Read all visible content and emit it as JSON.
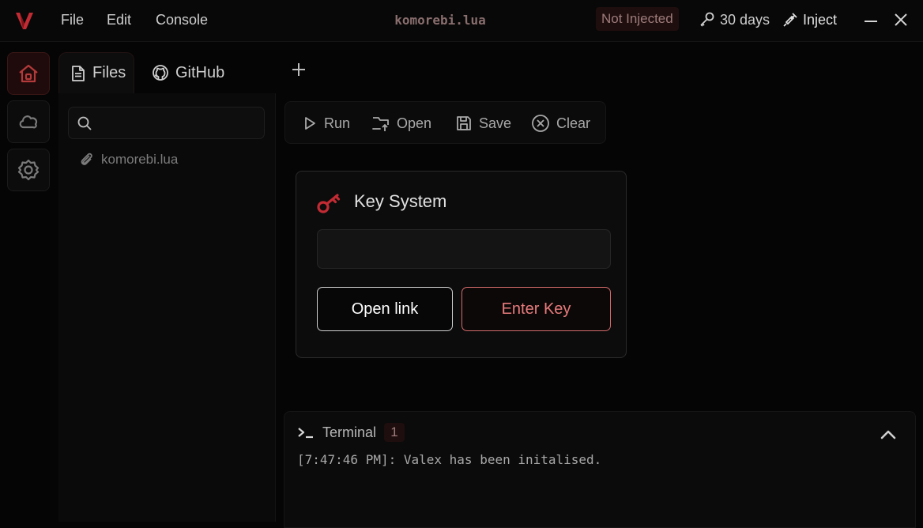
{
  "app": {
    "menu": [
      {
        "label": "File"
      },
      {
        "label": "Edit"
      },
      {
        "label": "Console"
      }
    ],
    "document_title": "komorebi.lua",
    "status_badge": "Not Injected",
    "key_days": "30 days",
    "inject_label": "Inject",
    "accent_color": "#c22b33"
  },
  "sidebar_tabs": [
    {
      "label": "Files",
      "icon": "file-icon"
    },
    {
      "label": "GitHub",
      "icon": "github-icon"
    }
  ],
  "search": {
    "placeholder": ""
  },
  "files": [
    {
      "name": "komorebi.lua",
      "icon": "link-icon"
    }
  ],
  "toolbar": {
    "run": "Run",
    "open": "Open",
    "save": "Save",
    "clear": "Clear"
  },
  "key_dialog": {
    "title": "Key System",
    "input_value": "",
    "open_link": "Open link",
    "enter_key": "Enter Key"
  },
  "terminal": {
    "title": "Terminal",
    "count": "1",
    "lines": [
      "[7:47:46 PM]: Valex has been initalised."
    ]
  }
}
